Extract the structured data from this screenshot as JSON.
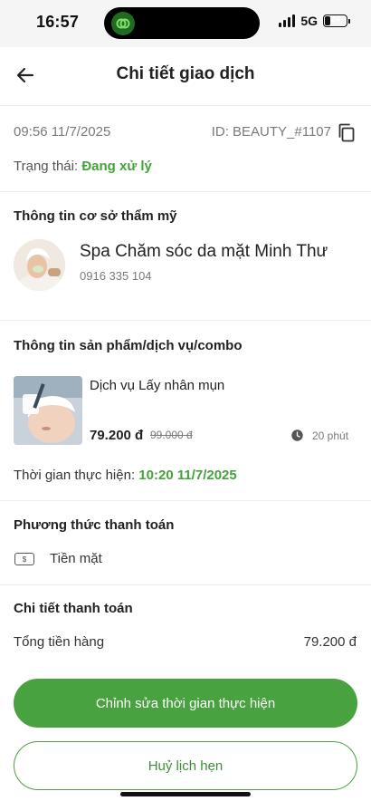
{
  "status_bar": {
    "time": "16:57",
    "network": "5G",
    "battery": "24",
    "battery_level": 0.24
  },
  "header": {
    "title": "Chi tiết giao dịch",
    "back_icon": "arrow-left-icon"
  },
  "transaction": {
    "datetime": "09:56 11/7/2025",
    "id": "ID: BEAUTY_#1107",
    "status_label": "Trạng thái:",
    "status_value": "Đang xử lý"
  },
  "facility": {
    "section_title": "Thông tin cơ sở thẩm mỹ",
    "name": "Spa Chăm sóc da mặt Minh Thư",
    "phone": "0916 335 104"
  },
  "service": {
    "section_title": "Thông tin sản phẩm/dịch vụ/combo",
    "name": "Dịch vụ Lấy nhân mụn",
    "price": "79.200 đ",
    "original_price": "99.000 đ",
    "duration": "20 phút",
    "time_label": "Thời gian thực hiện:",
    "time_value": "10:20 11/7/2025"
  },
  "payment_method": {
    "section_title": "Phương thức thanh toán",
    "method": "Tiền mặt",
    "icon_symbol": "$"
  },
  "payment_detail": {
    "section_title": "Chi tiết thanh toán",
    "total_label": "Tổng tiền hàng",
    "total_value": "79.200 đ"
  },
  "actions": {
    "edit_time": "Chỉnh sửa thời gian thực hiện",
    "cancel": "Huỷ lịch hẹn"
  },
  "colors": {
    "accent": "#48a23f",
    "status_green": "#43a33a",
    "muted": "#7a7a7a"
  }
}
